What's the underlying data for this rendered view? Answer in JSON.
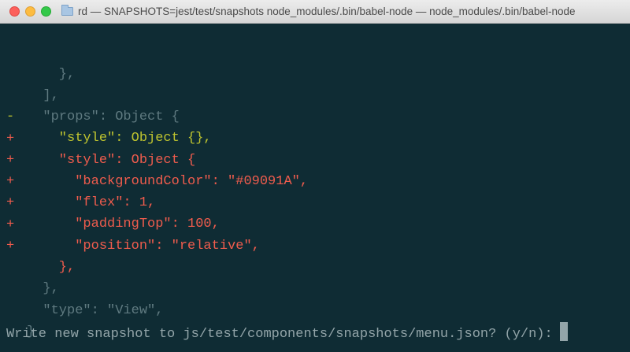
{
  "window": {
    "title": "rd — SNAPSHOTS=jest/test/snapshots node_modules/.bin/babel-node  — node_modules/.bin/babel-node"
  },
  "icons": {
    "close": "close-icon",
    "minimize": "minimize-icon",
    "zoom": "zoom-icon",
    "folder": "folder-icon"
  },
  "colors": {
    "background": "#0f2c34",
    "context": "#5f7a80",
    "removed": "#bfc42f",
    "added": "#f05c4d",
    "prompt": "#93a5a9"
  },
  "diff": {
    "lines": [
      {
        "marker": "",
        "text": "    },",
        "kind": "context"
      },
      {
        "marker": "",
        "text": "  ],",
        "kind": "context"
      },
      {
        "marker": "",
        "text": "  \"props\": Object {",
        "kind": "context"
      },
      {
        "marker": "-",
        "text": "    \"style\": Object {},",
        "kind": "removed"
      },
      {
        "marker": "+",
        "text": "    \"style\": Object {",
        "kind": "added"
      },
      {
        "marker": "+",
        "text": "      \"backgroundColor\": \"#09091A\",",
        "kind": "added"
      },
      {
        "marker": "+",
        "text": "      \"flex\": 1,",
        "kind": "added"
      },
      {
        "marker": "+",
        "text": "      \"paddingTop\": 100,",
        "kind": "added"
      },
      {
        "marker": "+",
        "text": "      \"position\": \"relative\",",
        "kind": "added"
      },
      {
        "marker": "+",
        "text": "    },",
        "kind": "added"
      },
      {
        "marker": "",
        "text": "  },",
        "kind": "context"
      },
      {
        "marker": "",
        "text": "  \"type\": \"View\",",
        "kind": "context"
      },
      {
        "marker": "",
        "text": "}",
        "kind": "context"
      }
    ]
  },
  "prompt": {
    "text": "Write new snapshot to js/test/components/snapshots/menu.json? (y/n):"
  }
}
